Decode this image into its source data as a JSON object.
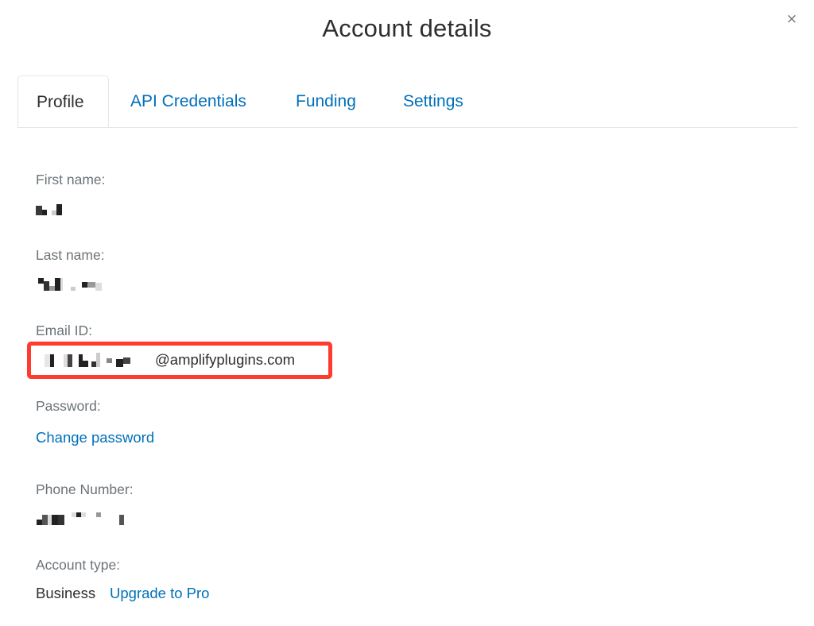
{
  "dialog": {
    "title": "Account details",
    "close_label": "×"
  },
  "tabs": [
    {
      "label": "Profile",
      "active": true
    },
    {
      "label": "API Credentials",
      "active": false
    },
    {
      "label": "Funding",
      "active": false
    },
    {
      "label": "Settings",
      "active": false
    }
  ],
  "profile": {
    "first_name": {
      "label": "First name:",
      "value_redacted": true
    },
    "last_name": {
      "label": "Last name:",
      "value_redacted": true
    },
    "email": {
      "label": "Email ID:",
      "value_redacted_prefix": true,
      "domain": "@amplifyplugins.com"
    },
    "password": {
      "label": "Password:",
      "action": "Change password"
    },
    "phone": {
      "label": "Phone Number:",
      "value_redacted": true
    },
    "account_type": {
      "label": "Account type:",
      "value": "Business",
      "action": "Upgrade to Pro"
    }
  },
  "colors": {
    "link": "#0070ba",
    "text": "#2c2e2f",
    "label": "#6c7378",
    "highlight_border": "#ff3b30"
  }
}
